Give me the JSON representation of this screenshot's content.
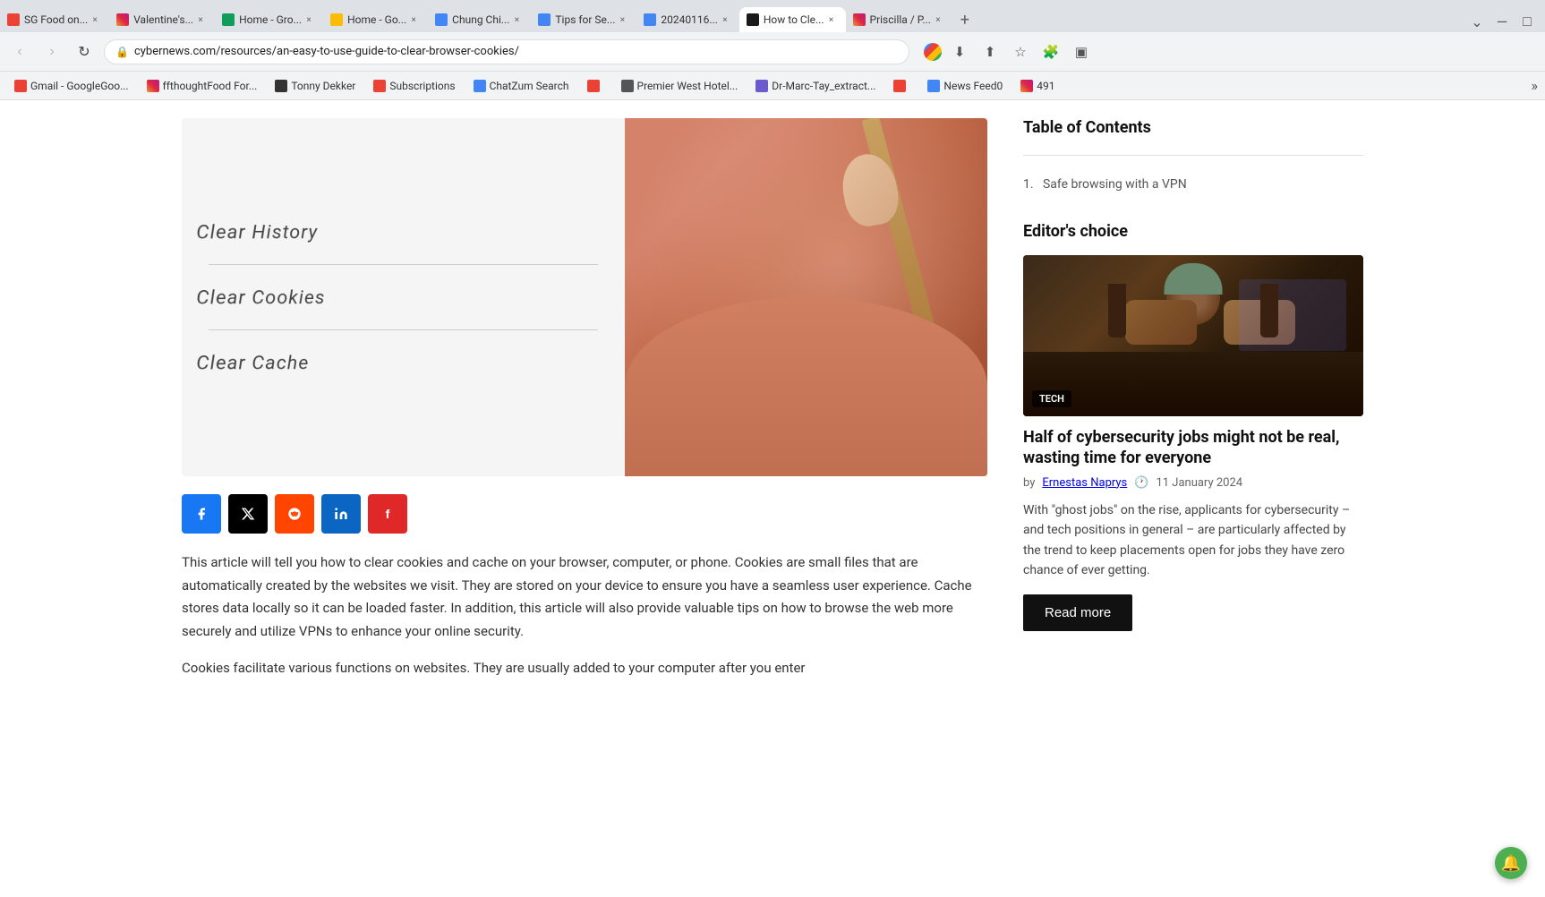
{
  "browser": {
    "tabs": [
      {
        "id": "tab1",
        "favicon_class": "favicon-red",
        "label": "SG Food on...",
        "active": false
      },
      {
        "id": "tab2",
        "favicon_class": "favicon-instagram",
        "label": "Valentine's...",
        "active": false
      },
      {
        "id": "tab3",
        "favicon_class": "favicon-green",
        "label": "Home - Gro...",
        "active": false
      },
      {
        "id": "tab4",
        "favicon_class": "favicon-yellow",
        "label": "Home - Go...",
        "active": false
      },
      {
        "id": "tab5",
        "favicon_class": "favicon-doc",
        "label": "Chung Chi...",
        "active": false
      },
      {
        "id": "tab6",
        "favicon_class": "favicon-doc",
        "label": "Tips for Se...",
        "active": false
      },
      {
        "id": "tab7",
        "favicon_class": "favicon-doc",
        "label": "20240116...",
        "active": false
      },
      {
        "id": "tab8",
        "favicon_class": "favicon-cybernews",
        "label": "How to Cle...",
        "active": true
      },
      {
        "id": "tab9",
        "favicon_class": "favicon-instagram",
        "label": "Priscilla / P...",
        "active": false
      }
    ],
    "url": "cybernewscom/resources/an-easy-to-use-guide-to-clear-browser-cookies/",
    "url_full": "cybernews.com/resources/an-easy-to-use-guide-to-clear-browser-cookies/"
  },
  "bookmarks": [
    {
      "label": "Gmail - GoogleGoo...",
      "favicon_class": "favicon-red"
    },
    {
      "label": "ffthoughtFood For...",
      "favicon_class": "favicon-instagram"
    },
    {
      "label": "Tonny Dekker",
      "favicon_class": ""
    },
    {
      "label": "Subscriptions",
      "favicon_class": "favicon-red"
    },
    {
      "label": "ChatZum Search",
      "favicon_class": ""
    },
    {
      "label": "Premier West Hotel...",
      "favicon_class": ""
    },
    {
      "label": "Dr-Marc-Tay_extract...",
      "favicon_class": ""
    },
    {
      "label": "News Feed0",
      "favicon_class": "favicon-blue"
    },
    {
      "label": "491",
      "favicon_class": "favicon-instagram"
    }
  ],
  "article": {
    "share_buttons": [
      {
        "id": "fb",
        "class": "share-fb",
        "icon": "f",
        "label": "Facebook"
      },
      {
        "id": "x",
        "class": "share-x",
        "icon": "𝕏",
        "label": "X"
      },
      {
        "id": "reddit",
        "class": "share-reddit",
        "icon": "●",
        "label": "Reddit"
      },
      {
        "id": "linkedin",
        "class": "share-linkedin",
        "icon": "in",
        "label": "LinkedIn"
      },
      {
        "id": "flipboard",
        "class": "share-flipboard",
        "icon": "f",
        "label": "Flipboard"
      }
    ],
    "paragraph1": "This article will tell you how to clear cookies and cache on your browser, computer, or phone. Cookies are small files that are automatically created by the websites we visit. They are stored on your device to ensure you have a seamless user experience. Cache stores data locally so it can be loaded faster. In addition, this article will also provide valuable tips on how to browse the web more securely and utilize VPNs to enhance your online security.",
    "paragraph2": "Cookies facilitate various functions on websites. They are usually added to your computer after you enter"
  },
  "sidebar": {
    "toc": {
      "title": "Table of Contents",
      "items": [
        {
          "number": "1.",
          "text": "Safe browsing with a VPN"
        }
      ]
    },
    "editors_choice": {
      "title": "Editor's choice",
      "badge": "TECH",
      "article_title": "Half of cybersecurity jobs might not be real, wasting time for everyone",
      "author_prefix": "by",
      "author": "Ernestas Naprys",
      "date": "11 January 2024",
      "description": "With \"ghost jobs\" on the rise, applicants for cybersecurity – and tech positions in general – are particularly affected by the trend to keep placements open for jobs they have zero chance of ever getting.",
      "read_more": "Read more"
    }
  },
  "image": {
    "menu_items": [
      "Clear History",
      "Clear Cookies",
      "Clear Cache"
    ],
    "alt": "Clear browser history, cookies and cache menu"
  }
}
